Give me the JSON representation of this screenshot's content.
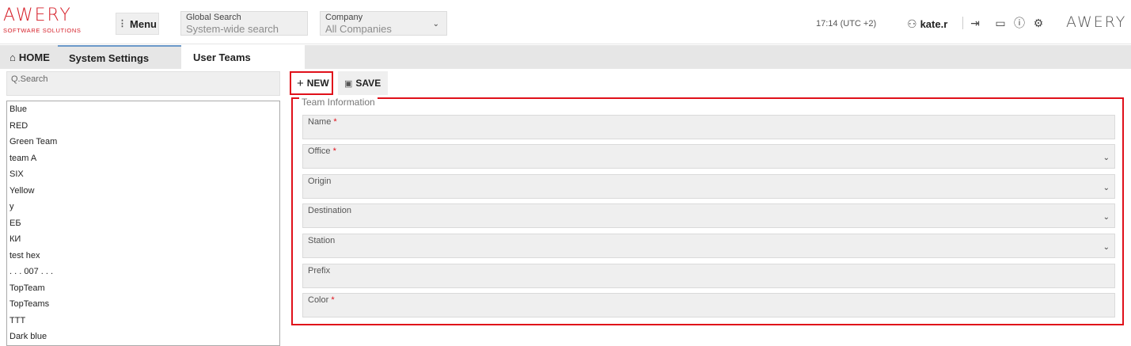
{
  "header": {
    "logo_text": "AWERY",
    "logo_sub": "SOFTWARE SOLUTIONS",
    "menu_label": "Menu",
    "global_search": {
      "label": "Global Search",
      "placeholder": "System-wide search"
    },
    "company": {
      "label": "Company",
      "value": "All Companies"
    },
    "time": "17:14 (UTC +2)",
    "username": "kate.r",
    "right_logo": "AWERY",
    "icons": [
      "user-icon",
      "logout-icon",
      "chat-icon",
      "info-icon",
      "settings-icon"
    ]
  },
  "tabs": [
    {
      "label": "HOME",
      "icon": "home-icon"
    },
    {
      "label": "System Settings"
    },
    {
      "label": "User Teams",
      "active": true
    }
  ],
  "left": {
    "search_placeholder": "Q.Search",
    "items": [
      "Blue",
      "RED",
      "Green Team",
      "team A",
      "SIX",
      "Yellow",
      "y",
      "ЕБ",
      "КИ",
      "test hex",
      ". . . 007 . . .",
      "TopTeam",
      "TopTeams",
      "TTT",
      "Dark blue"
    ]
  },
  "toolbar": {
    "new_label": "NEW",
    "save_label": "SAVE"
  },
  "form": {
    "legend": "Team Information",
    "fields": [
      {
        "label": "Name",
        "required": true,
        "dropdown": false
      },
      {
        "label": "Office",
        "required": true,
        "dropdown": true
      },
      {
        "label": "Origin",
        "required": false,
        "dropdown": true
      },
      {
        "label": "Destination",
        "required": false,
        "dropdown": true
      },
      {
        "label": "Station",
        "required": false,
        "dropdown": true
      },
      {
        "label": "Prefix",
        "required": false,
        "dropdown": false
      },
      {
        "label": "Color",
        "required": true,
        "dropdown": false
      }
    ]
  },
  "colors": {
    "brand": "#d6202a",
    "highlight": "#e0101a",
    "active_tab_border": "#6a98c8"
  }
}
